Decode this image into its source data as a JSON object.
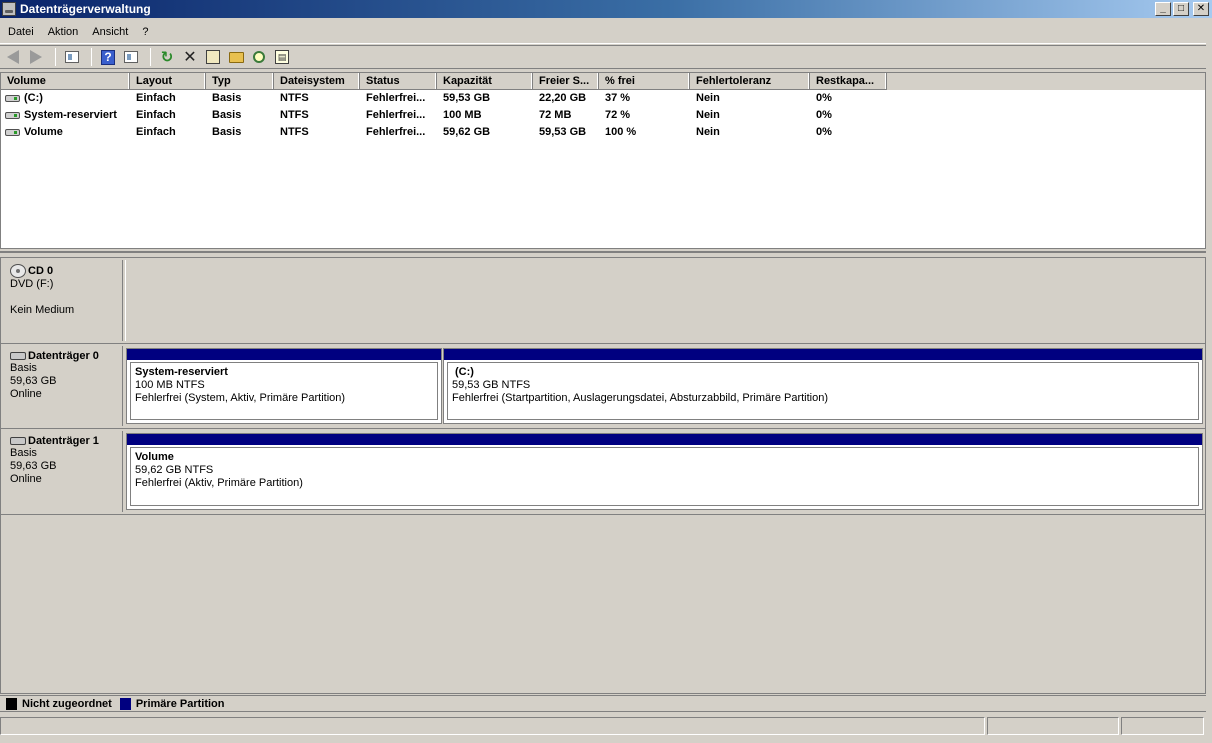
{
  "window": {
    "title": "Datenträgerverwaltung",
    "icon": "disk-management-icon",
    "controls": [
      "_",
      "□",
      "✕"
    ]
  },
  "menu": [
    "Datei",
    "Aktion",
    "Ansicht",
    "?"
  ],
  "toolbar": {
    "buttons": [
      "back-icon",
      "forward-icon",
      "console-tree-icon",
      "help-icon",
      "console-icon",
      "refresh-icon",
      "delete-icon",
      "properties-icon",
      "open-icon",
      "search-icon",
      "rescan-icon"
    ]
  },
  "volume_list": {
    "columns": [
      "Volume",
      "Layout",
      "Typ",
      "Dateisystem",
      "Status",
      "Kapazität",
      "Freier S...",
      "% frei",
      "Fehlertoleranz",
      "Restkapa..."
    ],
    "rows": [
      [
        "(C:)",
        "Einfach",
        "Basis",
        "NTFS",
        "Fehlerfrei...",
        "59,53 GB",
        "22,20 GB",
        "37 %",
        "Nein",
        "0%"
      ],
      [
        "System-reserviert",
        "Einfach",
        "Basis",
        "NTFS",
        "Fehlerfrei...",
        "100 MB",
        "72 MB",
        "72 %",
        "Nein",
        "0%"
      ],
      [
        "Volume",
        "Einfach",
        "Basis",
        "NTFS",
        "Fehlerfrei...",
        "59,62 GB",
        "59,53 GB",
        "100 %",
        "Nein",
        "0%"
      ]
    ]
  },
  "disks": [
    {
      "name": "CD 0",
      "lines": [
        "DVD (F:)",
        "",
        "Kein Medium"
      ],
      "partitions": []
    },
    {
      "name": "Datenträger 0",
      "lines": [
        "Basis",
        "59,63 GB",
        "Online"
      ],
      "partitions": [
        {
          "name": "System-reserviert",
          "size": "100 MB NTFS",
          "status": "Fehlerfrei (System, Aktiv, Primäre Partition)"
        },
        {
          "name": "(C:)",
          "size": "59,53 GB NTFS",
          "status": "Fehlerfrei (Startpartition, Auslagerungsdatei, Absturzabbild, Primäre Partition)"
        }
      ]
    },
    {
      "name": "Datenträger 1",
      "lines": [
        "Basis",
        "59,63 GB",
        "Online"
      ],
      "partitions": [
        {
          "name": "Volume",
          "size": "59,62 GB NTFS",
          "status": "Fehlerfrei (Aktiv, Primäre Partition)"
        }
      ]
    }
  ],
  "legend": [
    {
      "label": "Nicht zugeordnet",
      "color": "#000000"
    },
    {
      "label": "Primäre Partition",
      "color": "#000080"
    }
  ],
  "colors": {
    "primary_partition": "#000080",
    "unallocated": "#000000",
    "titlebar_start": "#0a246a"
  }
}
